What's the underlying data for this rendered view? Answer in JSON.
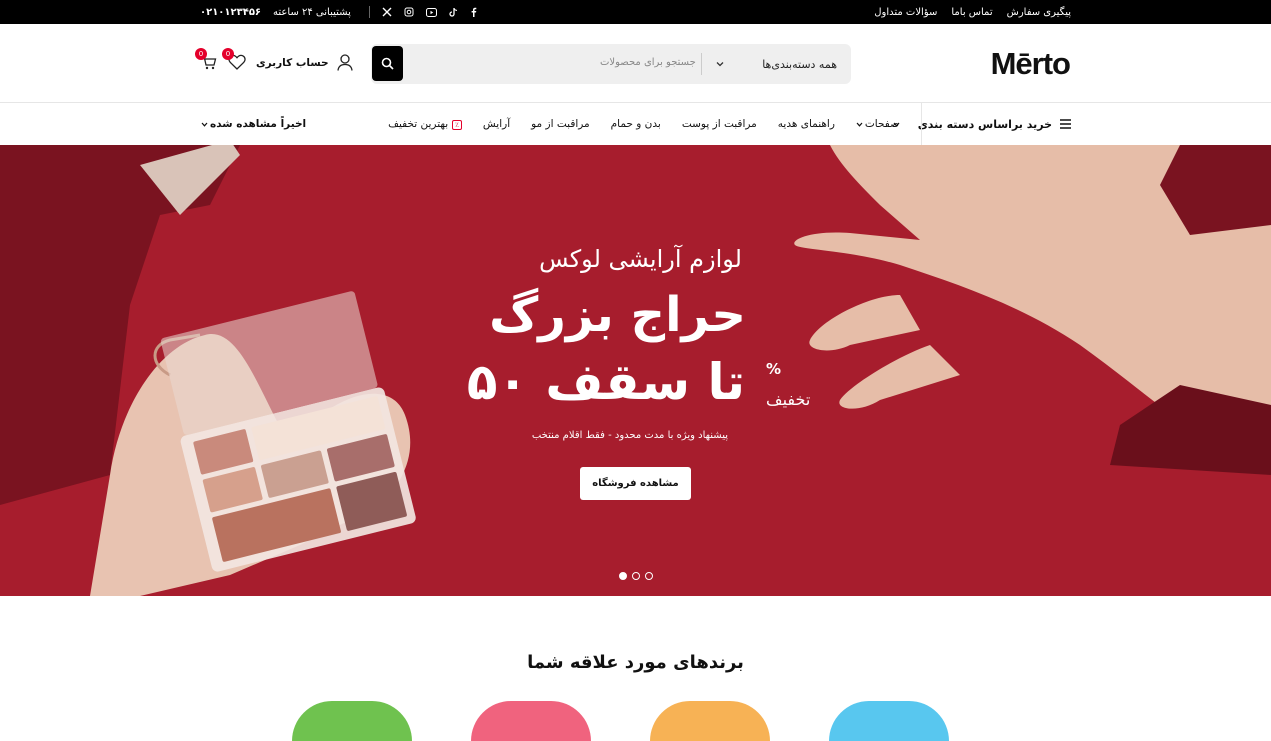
{
  "topbar": {
    "links": [
      "پیگیری سفارش",
      "تماس باما",
      "سؤالات متداول"
    ],
    "support_label": "پشتیبانی ۲۴ ساعته",
    "phone": "۰۲۱۰۱۲۳۴۵۶",
    "social_icons": [
      "facebook-icon",
      "tiktok-icon",
      "youtube-icon",
      "instagram-icon",
      "x-icon"
    ]
  },
  "header": {
    "logo": "Mērto",
    "search": {
      "category": "همه دسته‌بندی‌ها",
      "placeholder": "جستجو برای محصولات"
    },
    "account_label": "حساب کاربری",
    "wishlist_count": "0",
    "cart_count": "0"
  },
  "nav": {
    "category_button": "خرید براساس دسته بندی",
    "items": [
      "صفحات",
      "راهنمای هدیه",
      "مراقبت از پوست",
      "بدن و حمام",
      "مراقبت از مو",
      "آرایش",
      "بهترین تخفیف"
    ],
    "discount_tag": "٪",
    "recent": "اخیراً مشاهده شده"
  },
  "hero": {
    "subtitle": "لوازم آرایشی لوکس",
    "title": "حراج بزرگ",
    "title2": "تا سقف ۵۰",
    "percent": "%",
    "discount_word": "تخفیف",
    "note": "پیشنهاد ویژه با مدت محدود - فقط اقلام منتخب",
    "cta": "مشاهده فروشگاه",
    "slides": 3,
    "active_slide": 1,
    "background": "#a71d2d"
  },
  "brands": {
    "title": "برندهای مورد علاقه شما",
    "card_colors": [
      "#6fc24f",
      "#f0637e",
      "#f7b255",
      "#58c7ef"
    ]
  }
}
